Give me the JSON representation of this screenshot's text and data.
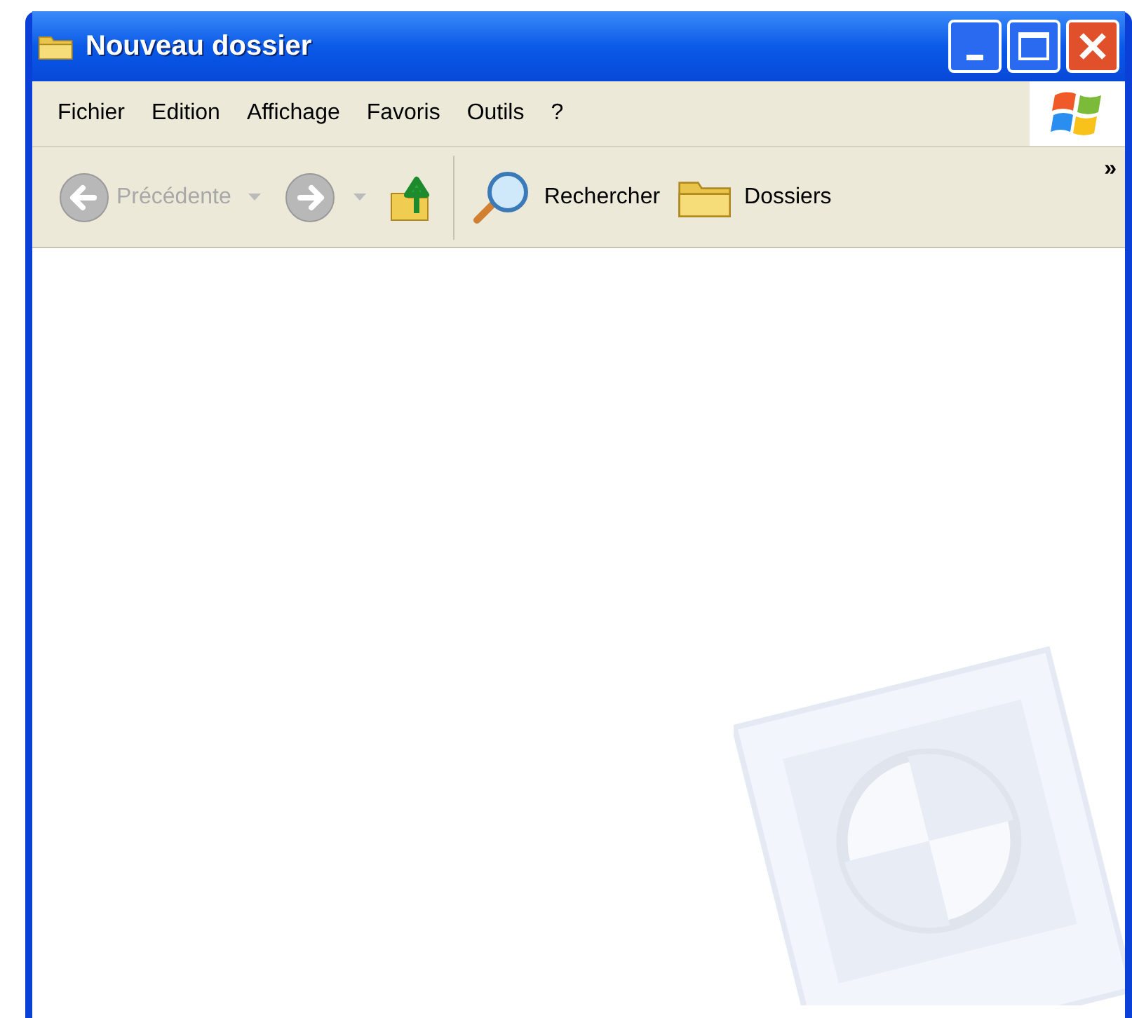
{
  "window": {
    "title": "Nouveau dossier"
  },
  "menu": [
    "Fichier",
    "Edition",
    "Affichage",
    "Favoris",
    "Outils",
    "?"
  ],
  "toolbar": {
    "buttons": [
      {
        "kind": "back",
        "label": "Précédente",
        "disabled": true
      },
      {
        "kind": "forward",
        "disabled": true
      },
      {
        "kind": "up",
        "disabled": false
      },
      {
        "kind": "search",
        "label": "Rechercher",
        "disabled": false
      },
      {
        "kind": "folders",
        "label": "Dossiers",
        "disabled": false
      }
    ],
    "overflow": "»"
  }
}
